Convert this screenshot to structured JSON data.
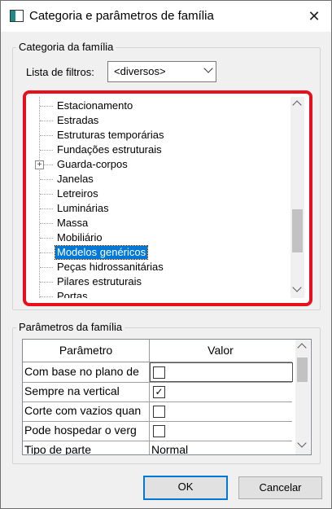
{
  "window": {
    "title": "Categoria e parâmetros de família",
    "close_glyph": "✕"
  },
  "category_group": {
    "label": "Categoria da família",
    "filter_label": "Lista de filtros:",
    "filter_value": "<diversos>",
    "tree_items": [
      {
        "label": "Estacionamento",
        "expandable": false
      },
      {
        "label": "Estradas",
        "expandable": false
      },
      {
        "label": "Estruturas temporárias",
        "expandable": false
      },
      {
        "label": "Fundações estruturais",
        "expandable": false
      },
      {
        "label": "Guarda-corpos",
        "expandable": true
      },
      {
        "label": "Janelas",
        "expandable": false
      },
      {
        "label": "Letreiros",
        "expandable": false
      },
      {
        "label": "Luminárias",
        "expandable": false
      },
      {
        "label": "Massa",
        "expandable": false
      },
      {
        "label": "Mobiliário",
        "expandable": false
      },
      {
        "label": "Modelos genéricos",
        "expandable": false,
        "selected": true
      },
      {
        "label": "Peças hidrossanitárias",
        "expandable": false
      },
      {
        "label": "Pilares estruturais",
        "expandable": false
      },
      {
        "label": "Portas",
        "expandable": false
      }
    ],
    "expander_glyph": "+"
  },
  "params_group": {
    "label": "Parâmetros da família",
    "columns": [
      "Parâmetro",
      "Valor"
    ],
    "rows": [
      {
        "name": "Com base no plano de",
        "type": "checkbox",
        "checked": false,
        "editing": true
      },
      {
        "name": "Sempre na vertical",
        "type": "checkbox",
        "checked": true
      },
      {
        "name": "Corte com vazios quan",
        "type": "checkbox",
        "checked": false
      },
      {
        "name": "Pode hospedar o verg",
        "type": "checkbox",
        "checked": false
      },
      {
        "name": "Tipo de parte",
        "type": "text",
        "value": "Normal"
      }
    ],
    "check_glyph": "✓"
  },
  "buttons": {
    "ok": "OK",
    "cancel": "Cancelar"
  },
  "colors": {
    "highlight_outline": "#e8101a",
    "selection": "#0078d7"
  }
}
